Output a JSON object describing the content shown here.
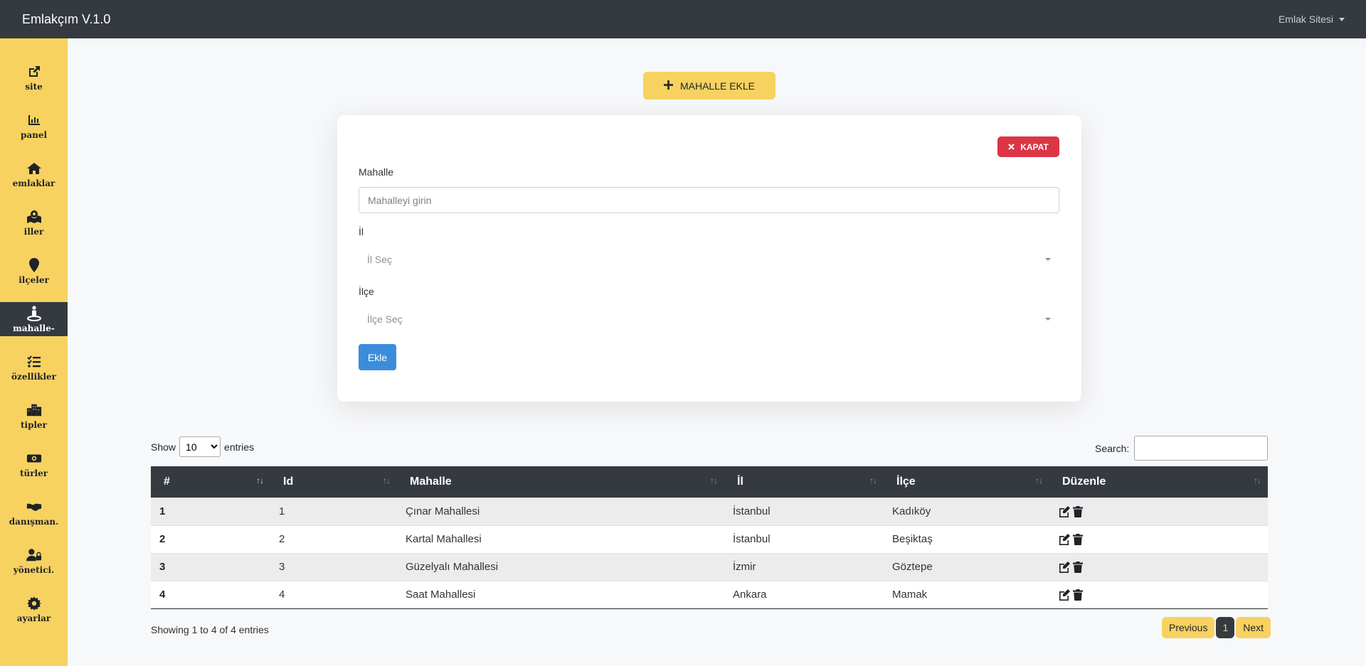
{
  "app": {
    "brand": "Emlakçım V.1.0",
    "user_menu": "Emlak Sitesi"
  },
  "sidebar": {
    "items": [
      {
        "label": "site",
        "icon": "external-link-icon"
      },
      {
        "label": "panel",
        "icon": "chart-bar-icon"
      },
      {
        "label": "emlaklar",
        "icon": "home-icon"
      },
      {
        "label": "iller",
        "icon": "map-marked-icon"
      },
      {
        "label": "ilçeler",
        "icon": "map-marker-icon"
      },
      {
        "label": "mahalle-",
        "icon": "street-view-icon",
        "active": true
      },
      {
        "label": "özellikler",
        "icon": "tasks-list-icon"
      },
      {
        "label": "tipler",
        "icon": "city-icon"
      },
      {
        "label": "türler",
        "icon": "money-bill-icon"
      },
      {
        "label": "danışman.",
        "icon": "handshake-icon"
      },
      {
        "label": "yönetici.",
        "icon": "user-lock-icon"
      },
      {
        "label": "ayarlar",
        "icon": "gear-icon"
      }
    ]
  },
  "add_button": {
    "label": "MAHALLE EKLE",
    "icon": "plus-icon"
  },
  "form": {
    "close_label": "KAPAT",
    "mahalle_label": "Mahalle",
    "mahalle_placeholder": "Mahalleyi girin",
    "il_label": "İl",
    "il_select": "İl Seç",
    "ilce_label": "İlçe",
    "ilce_select": "İlçe Seç",
    "submit_label": "Ekle"
  },
  "table": {
    "show_label": "Show",
    "entries_label": "entries",
    "page_size": "10",
    "search_label": "Search:",
    "columns": [
      "#",
      "Id",
      "Mahalle",
      "İl",
      "İlçe",
      "Düzenle"
    ],
    "rows": [
      {
        "num": "1",
        "id": "1",
        "mahalle": "Çınar Mahallesi",
        "il": "İstanbul",
        "ilce": "Kadıköy"
      },
      {
        "num": "2",
        "id": "2",
        "mahalle": "Kartal Mahallesi",
        "il": "İstanbul",
        "ilce": "Beşiktaş"
      },
      {
        "num": "3",
        "id": "3",
        "mahalle": "Güzelyalı Mahallesi",
        "il": "İzmir",
        "ilce": "Göztepe"
      },
      {
        "num": "4",
        "id": "4",
        "mahalle": "Saat Mahallesi",
        "il": "Ankara",
        "ilce": "Mamak"
      }
    ],
    "info": "Showing 1 to 4 of 4 entries",
    "pagination": {
      "previous": "Previous",
      "current": "1",
      "next": "Next"
    }
  },
  "colors": {
    "accent": "#f7d260",
    "dark": "#343a40",
    "danger": "#dc3545",
    "primary": "#3b8ddb"
  }
}
